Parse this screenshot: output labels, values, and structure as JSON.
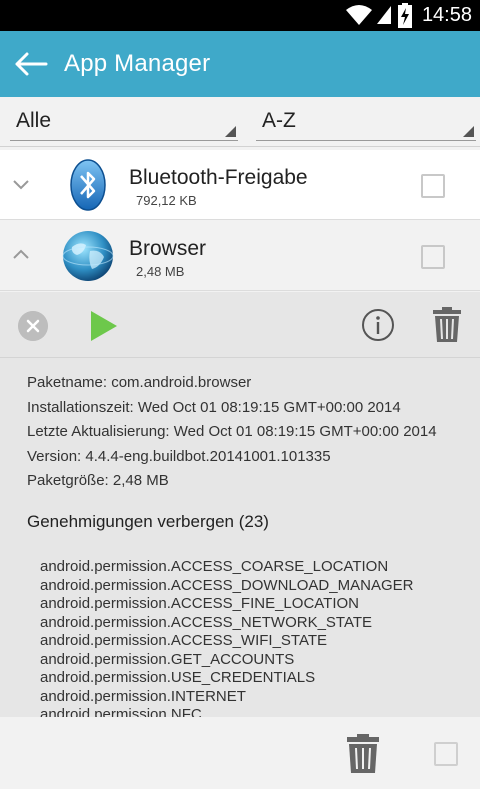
{
  "status_bar": {
    "time": "14:58",
    "icons": [
      "wifi-icon",
      "signal-icon",
      "battery-charging-icon"
    ]
  },
  "app_bar": {
    "back_icon": "back-arrow-icon",
    "title": "App Manager",
    "color": "#3fa9c9"
  },
  "filters": {
    "category": "Alle",
    "sort": "A-Z"
  },
  "apps": [
    {
      "name": "Bluetooth-Freigabe",
      "size": "792,12 KB",
      "icon": "bluetooth-icon",
      "expanded": false
    },
    {
      "name": "Browser",
      "size": "2,48 MB",
      "icon": "globe-icon",
      "expanded": true
    }
  ],
  "detail": {
    "actions": [
      "stop-icon",
      "play-icon",
      "info-icon",
      "trash-icon"
    ],
    "package": "Paketname: com.android.browser",
    "installed": "Installationszeit: Wed Oct 01 08:19:15 GMT+00:00 2014",
    "updated": "Letzte Aktualisierung: Wed Oct 01 08:19:15 GMT+00:00 2014",
    "version": "Version: 4.4.4-eng.buildbot.20141001.101335",
    "size": "Paketgröße: 2,48 MB",
    "permissions_title": "Genehmigungen verbergen (23)",
    "permissions": [
      "android.permission.ACCESS_COARSE_LOCATION",
      "android.permission.ACCESS_DOWNLOAD_MANAGER",
      "android.permission.ACCESS_FINE_LOCATION",
      "android.permission.ACCESS_NETWORK_STATE",
      "android.permission.ACCESS_WIFI_STATE",
      "android.permission.GET_ACCOUNTS",
      "android.permission.USE_CREDENTIALS",
      "android.permission.INTERNET",
      "android.permission.NFC"
    ]
  },
  "bottom_bar": {
    "icons": [
      "trash-icon",
      "checkbox"
    ]
  }
}
